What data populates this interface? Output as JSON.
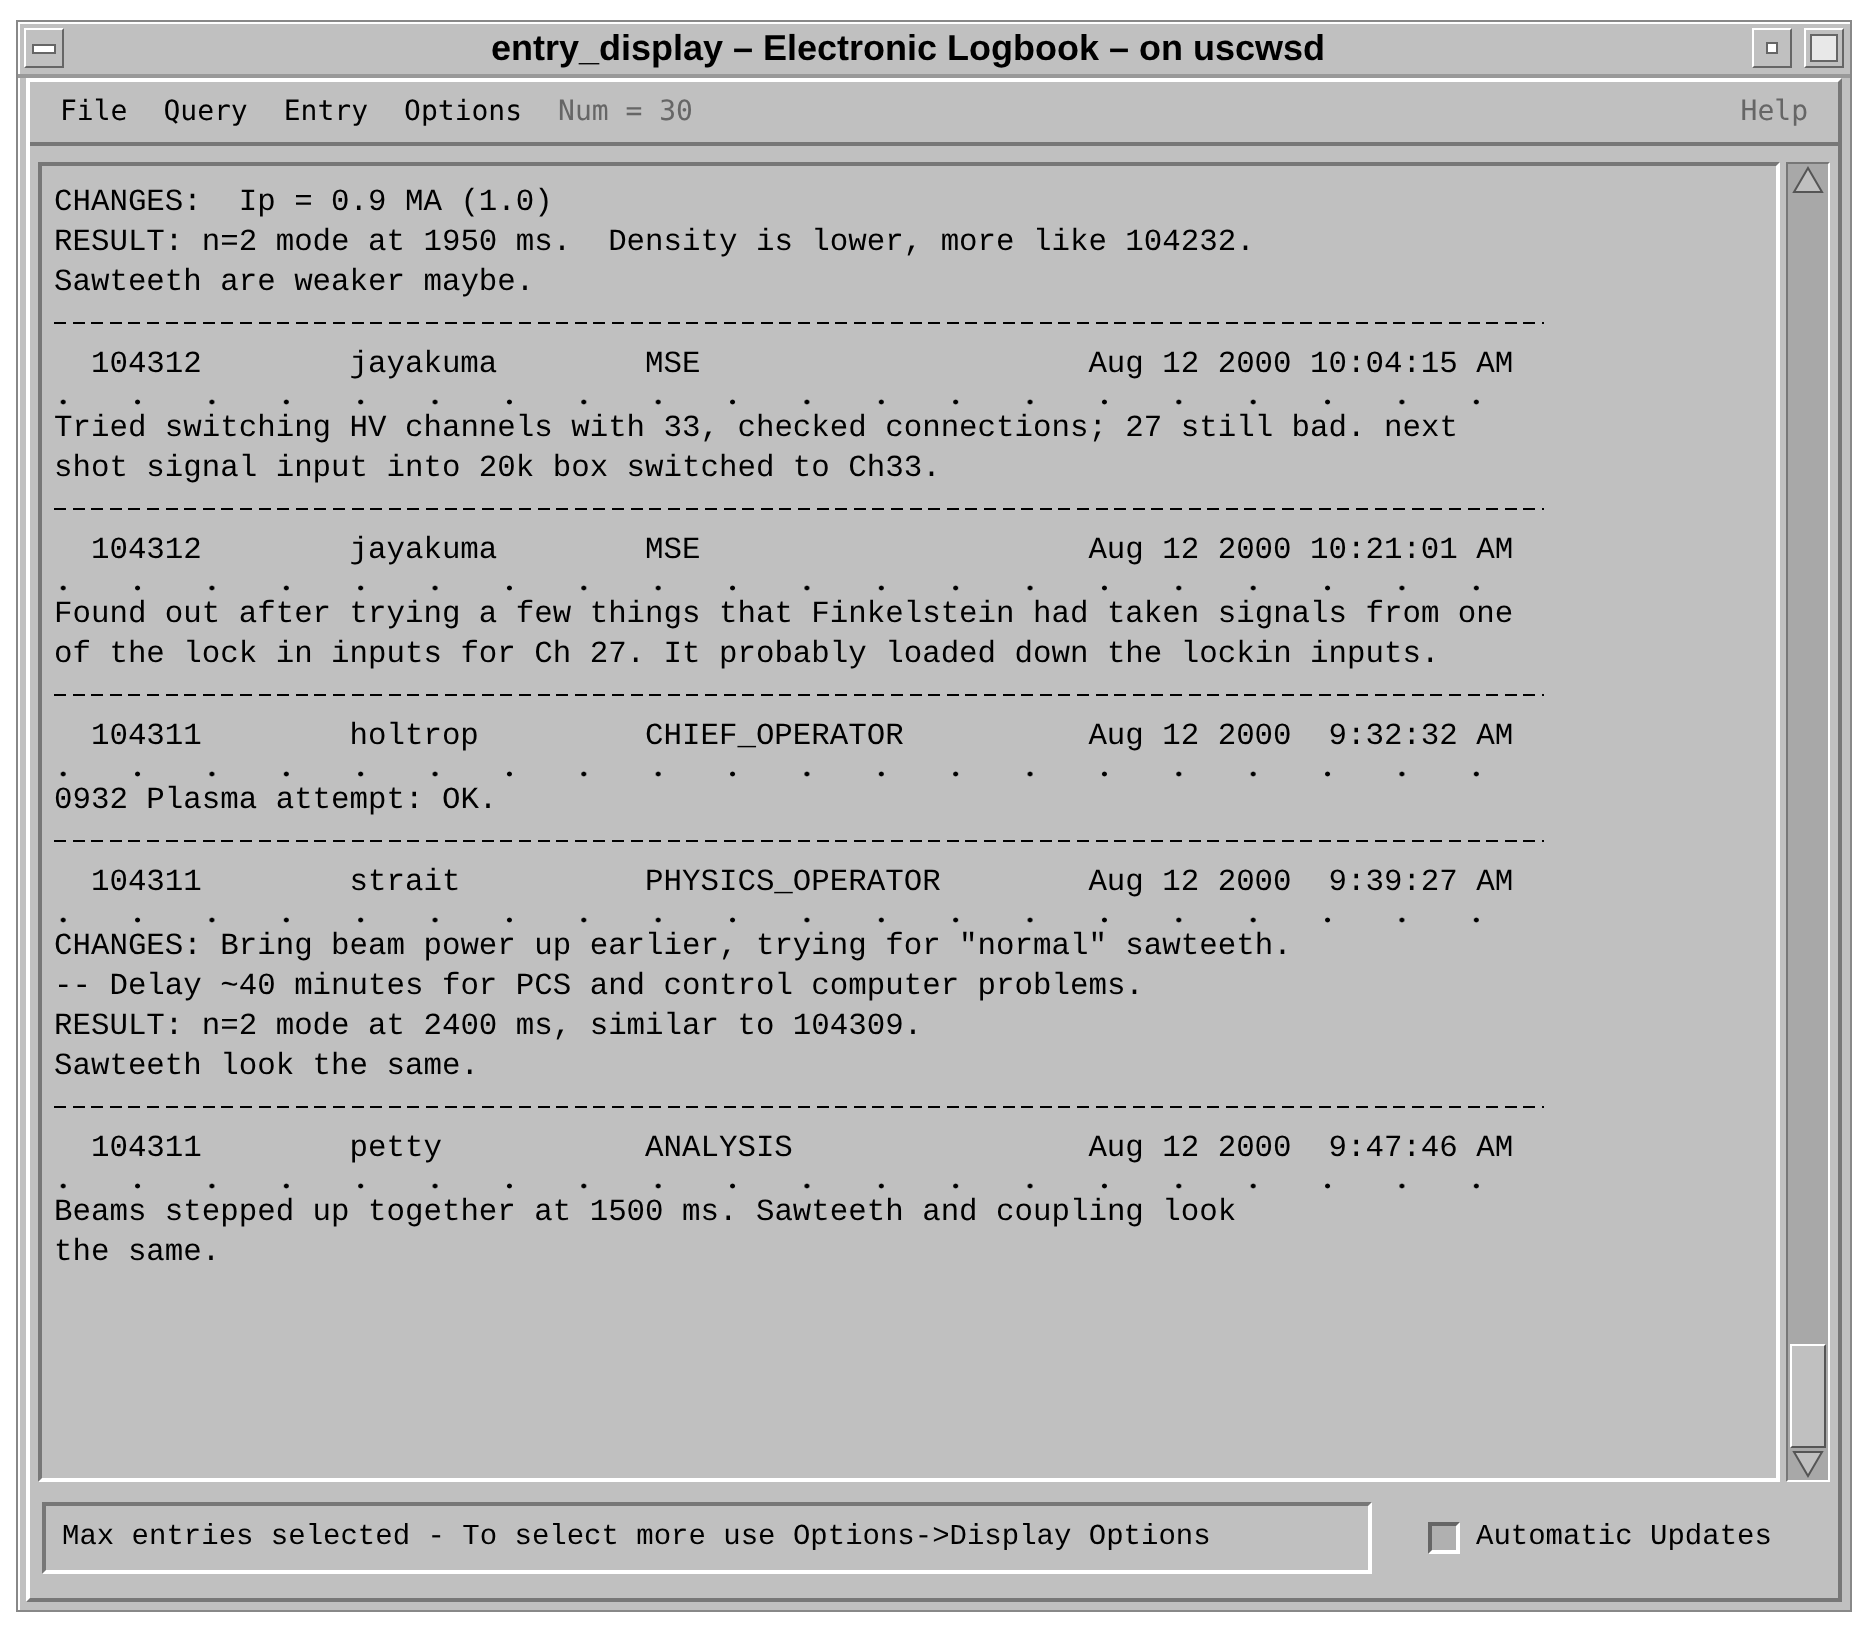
{
  "window": {
    "title": "entry_display – Electronic Logbook – on uscwsd"
  },
  "menu": [
    {
      "label": "File",
      "disabled": false
    },
    {
      "label": "Query",
      "disabled": false
    },
    {
      "label": "Entry",
      "disabled": false
    },
    {
      "label": "Options",
      "disabled": false
    },
    {
      "label": "Num = 30",
      "disabled": true
    }
  ],
  "help_menu": {
    "label": "Help",
    "disabled": true
  },
  "log": {
    "lead_lines": [
      "CHANGES:  Ip = 0.9 MA (1.0)",
      "RESULT: n=2 mode at 1950 ms.  Density is lower, more like 104232.",
      "Sawteeth are weaker maybe."
    ],
    "entries": [
      {
        "shot": "104312",
        "user": "jayakuma",
        "category": "MSE",
        "timestamp": "Aug 12 2000 10:04:15 AM",
        "lines": [
          "Tried switching HV channels with 33, checked connections; 27 still bad. next",
          "shot signal input into 20k box switched to Ch33."
        ]
      },
      {
        "shot": "104312",
        "user": "jayakuma",
        "category": "MSE",
        "timestamp": "Aug 12 2000 10:21:01 AM",
        "lines": [
          "Found out after trying a few things that Finkelstein had taken signals from one",
          "of the lock in inputs for Ch 27. It probably loaded down the lockin inputs."
        ]
      },
      {
        "shot": "104311",
        "user": "holtrop",
        "category": "CHIEF_OPERATOR",
        "timestamp": "Aug 12 2000  9:32:32 AM",
        "lines": [
          "0932 Plasma attempt: OK."
        ]
      },
      {
        "shot": "104311",
        "user": "strait",
        "category": "PHYSICS_OPERATOR",
        "timestamp": "Aug 12 2000  9:39:27 AM",
        "lines": [
          "CHANGES: Bring beam power up earlier, trying for \"normal\" sawteeth.",
          "-- Delay ~40 minutes for PCS and control computer problems.",
          "RESULT: n=2 mode at 2400 ms, similar to 104309.",
          "Sawteeth look the same."
        ]
      },
      {
        "shot": "104311",
        "user": "petty",
        "category": "ANALYSIS",
        "timestamp": "Aug 12 2000  9:47:46 AM",
        "lines": [
          "Beams stepped up together at 1500 ms. Sawteeth and coupling look",
          "the same."
        ]
      }
    ]
  },
  "status": {
    "message": "Max entries selected - To select more use Options->Display Options"
  },
  "automatic_updates": {
    "label": "Automatic Updates",
    "checked": false
  }
}
